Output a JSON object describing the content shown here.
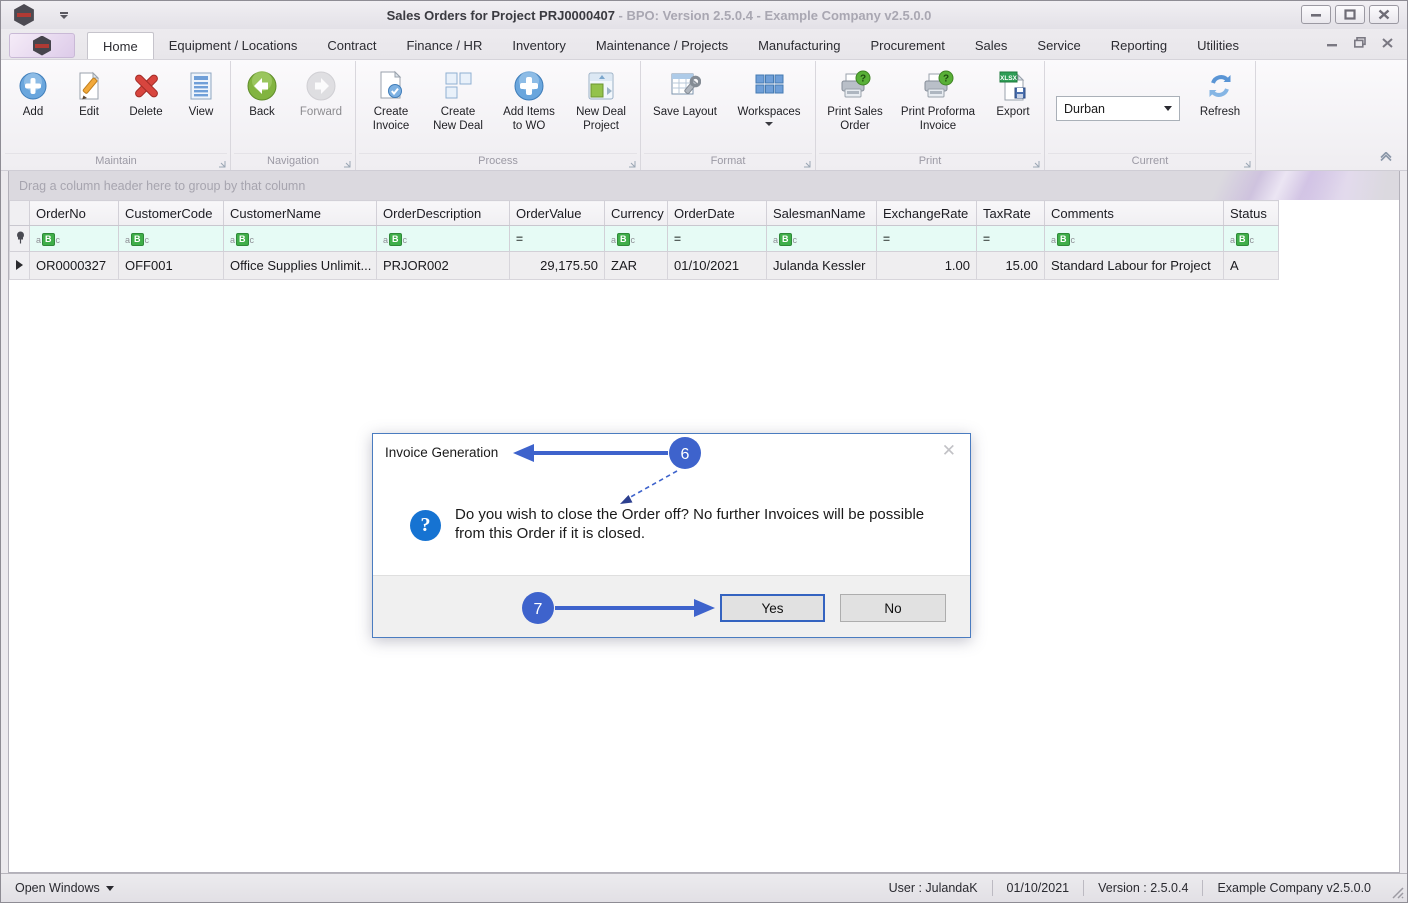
{
  "window": {
    "title_main": "Sales Orders for Project PRJ0000407",
    "title_suffix": " - BPO: Version 2.5.0.4 - Example Company v2.5.0.0"
  },
  "tab_bar": {
    "tabs": [
      "Home",
      "Equipment / Locations",
      "Contract",
      "Finance / HR",
      "Inventory",
      "Maintenance / Projects",
      "Manufacturing",
      "Procurement",
      "Sales",
      "Service",
      "Reporting",
      "Utilities"
    ],
    "active_tab": "Home"
  },
  "ribbon": {
    "groups": [
      {
        "label": "Maintain",
        "buttons": [
          {
            "label": "Add"
          },
          {
            "label": "Edit"
          },
          {
            "label": "Delete"
          },
          {
            "label": "View"
          }
        ]
      },
      {
        "label": "Navigation",
        "buttons": [
          {
            "label": "Back"
          },
          {
            "label": "Forward",
            "disabled": true
          }
        ]
      },
      {
        "label": "Process",
        "buttons": [
          {
            "label": "Create\nInvoice"
          },
          {
            "label": "Create\nNew Deal"
          },
          {
            "label": "Add Items\nto WO"
          },
          {
            "label": "New Deal\nProject"
          }
        ]
      },
      {
        "label": "Format",
        "buttons": [
          {
            "label": "Save Layout"
          },
          {
            "label": "Workspaces"
          }
        ]
      },
      {
        "label": "Print",
        "buttons": [
          {
            "label": "Print Sales\nOrder"
          },
          {
            "label": "Print Proforma\nInvoice"
          },
          {
            "label": "Export"
          }
        ]
      },
      {
        "label": "Current",
        "combo_value": "Durban",
        "buttons": [
          {
            "label": "Refresh"
          }
        ]
      }
    ]
  },
  "icons": {
    "text_filter_a": "a",
    "text_filter_b": "B",
    "text_filter_c": "c",
    "numeric_filter": "=",
    "xlsx_label": "XLSX"
  },
  "grid": {
    "group_panel_text": "Drag a column header here to group by that column",
    "columns": [
      {
        "name": "OrderNo",
        "filter": "text"
      },
      {
        "name": "CustomerCode",
        "filter": "text"
      },
      {
        "name": "CustomerName",
        "filter": "text"
      },
      {
        "name": "OrderDescription",
        "filter": "text"
      },
      {
        "name": "OrderValue",
        "filter": "numeric"
      },
      {
        "name": "Currency",
        "filter": "text"
      },
      {
        "name": "OrderDate",
        "filter": "numeric"
      },
      {
        "name": "SalesmanName",
        "filter": "text"
      },
      {
        "name": "ExchangeRate",
        "filter": "numeric"
      },
      {
        "name": "TaxRate",
        "filter": "numeric"
      },
      {
        "name": "Comments",
        "filter": "text"
      },
      {
        "name": "Status",
        "filter": "text"
      }
    ],
    "rows": [
      {
        "cells": [
          "OR0000327",
          "OFF001",
          "Office Supplies Unlimit...",
          "PRJOR002",
          "29,175.50",
          "ZAR",
          "01/10/2021",
          "Julanda Kessler",
          "1.00",
          "15.00",
          "Standard Labour for Project",
          "A"
        ]
      }
    ]
  },
  "dialog": {
    "title": "Invoice Generation",
    "message": "Do you wish to close the Order off? No further Invoices will be possible from this Order if it is closed.",
    "yes_label": "Yes",
    "no_label": "No"
  },
  "annotations": {
    "badge6": "6",
    "badge7": "7",
    "accent_color": "#3e63cc"
  },
  "status_bar": {
    "open_windows": "Open Windows",
    "user": "User : JulandaK",
    "date": "01/10/2021",
    "version": "Version : 2.5.0.4",
    "company": "Example Company v2.5.0.0"
  }
}
